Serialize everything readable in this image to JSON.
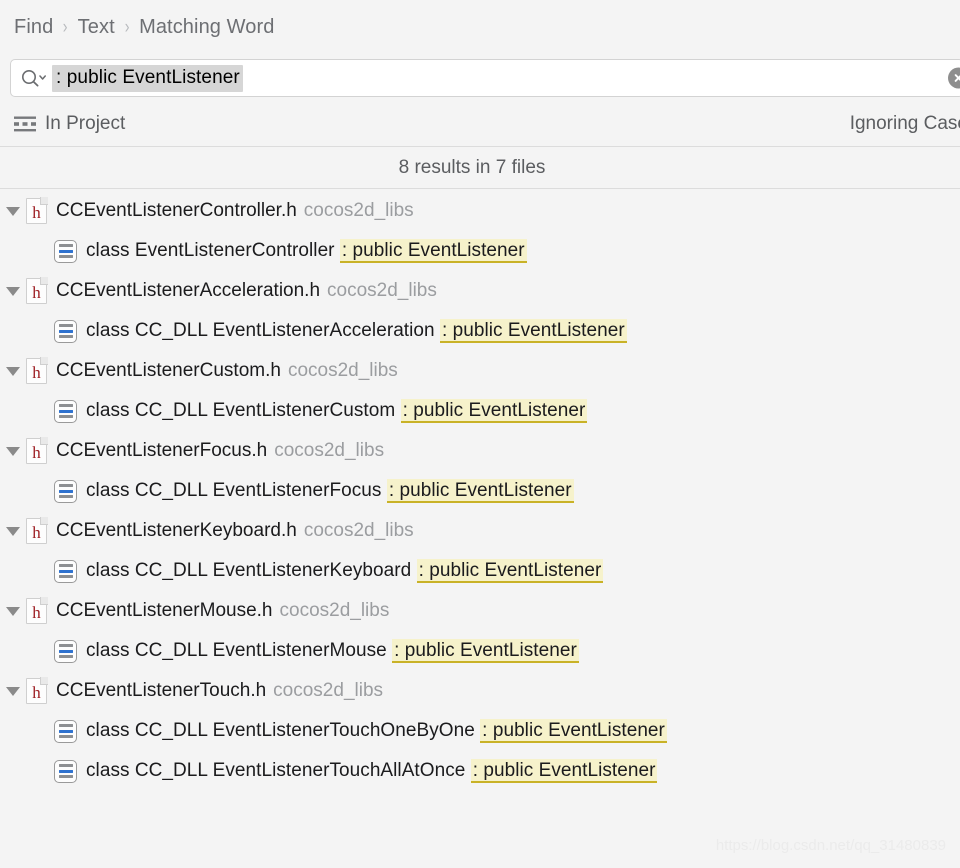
{
  "breadcrumb": {
    "items": [
      "Find",
      "Text",
      "Matching Word"
    ],
    "separator": "›"
  },
  "search": {
    "icon": "magnifier-chevron-icon",
    "value": ": public EventListener",
    "clear_icon": "clear-circle-icon"
  },
  "scope": {
    "icon": "scope-lines-icon",
    "label": "In Project",
    "options_label": "Ignoring Case"
  },
  "summary": {
    "text": "8 results in 7 files"
  },
  "colors": {
    "highlight_bg": "#f6f2cb",
    "highlight_underline": "#c9b227",
    "match_icon_accent": "#2f72cf",
    "file_letter": "#9e1f24",
    "window_bg": "#f4f4f4"
  },
  "results": [
    {
      "file": "CCEventListenerController.h",
      "project": "cocos2d_libs",
      "badge": "h",
      "expanded": true,
      "matches": [
        {
          "prefix": "class EventListenerController ",
          "highlight": ": public EventListener"
        }
      ]
    },
    {
      "file": "CCEventListenerAcceleration.h",
      "project": "cocos2d_libs",
      "badge": "h",
      "expanded": true,
      "matches": [
        {
          "prefix": "class CC_DLL EventListenerAcceleration ",
          "highlight": ": public EventListener"
        }
      ]
    },
    {
      "file": "CCEventListenerCustom.h",
      "project": "cocos2d_libs",
      "badge": "h",
      "expanded": true,
      "matches": [
        {
          "prefix": "class CC_DLL EventListenerCustom ",
          "highlight": ": public EventListener"
        }
      ]
    },
    {
      "file": "CCEventListenerFocus.h",
      "project": "cocos2d_libs",
      "badge": "h",
      "expanded": true,
      "matches": [
        {
          "prefix": "class CC_DLL EventListenerFocus ",
          "highlight": ": public EventListener"
        }
      ]
    },
    {
      "file": "CCEventListenerKeyboard.h",
      "project": "cocos2d_libs",
      "badge": "h",
      "expanded": true,
      "matches": [
        {
          "prefix": "class CC_DLL EventListenerKeyboard ",
          "highlight": ": public EventListener"
        }
      ]
    },
    {
      "file": "CCEventListenerMouse.h",
      "project": "cocos2d_libs",
      "badge": "h",
      "expanded": true,
      "matches": [
        {
          "prefix": "class CC_DLL EventListenerMouse ",
          "highlight": ": public EventListener"
        }
      ]
    },
    {
      "file": "CCEventListenerTouch.h",
      "project": "cocos2d_libs",
      "badge": "h",
      "expanded": true,
      "matches": [
        {
          "prefix": "class CC_DLL EventListenerTouchOneByOne ",
          "highlight": ": public EventListener"
        },
        {
          "prefix": "class CC_DLL EventListenerTouchAllAtOnce ",
          "highlight": ": public EventListener"
        }
      ]
    }
  ],
  "watermark": {
    "text": "https://blog.csdn.net/qq_31480839"
  }
}
